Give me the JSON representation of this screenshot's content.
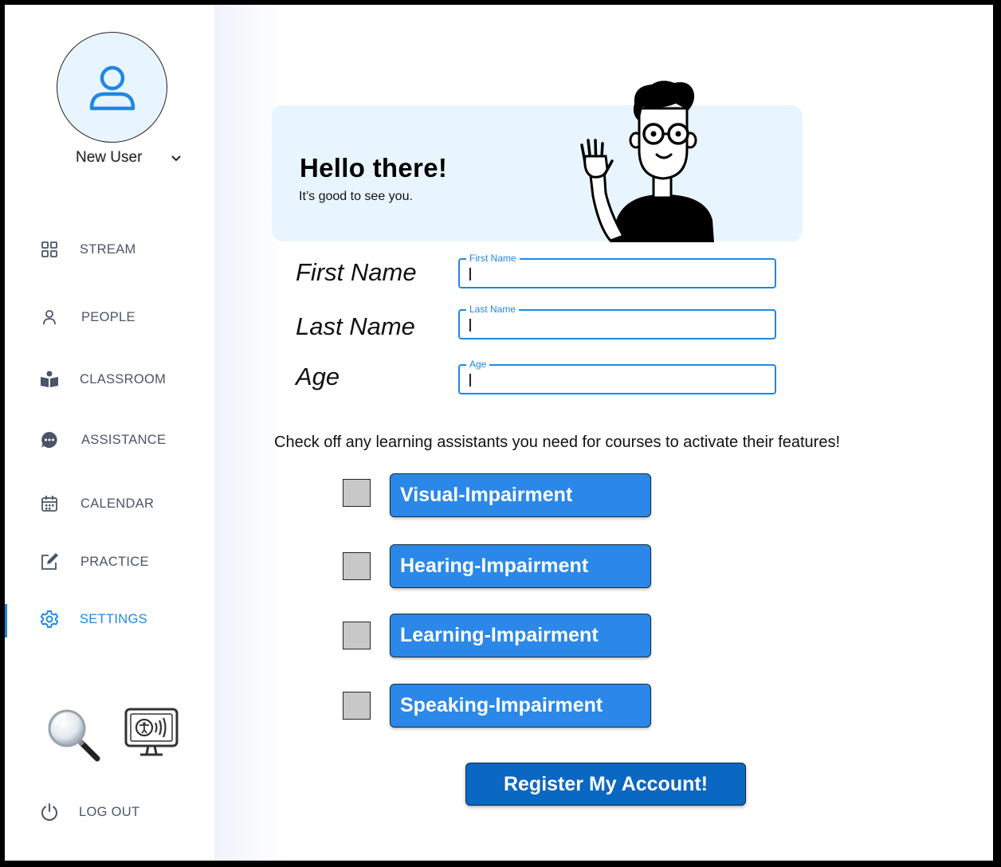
{
  "sidebar": {
    "user_name": "New User",
    "nav": [
      {
        "label": "STREAM",
        "icon": "grid-icon"
      },
      {
        "label": "PEOPLE",
        "icon": "person-icon"
      },
      {
        "label": "CLASSROOM",
        "icon": "book-reader-icon"
      },
      {
        "label": "ASSISTANCE",
        "icon": "chat-bubble-icon"
      },
      {
        "label": "CALENDAR",
        "icon": "calendar-icon"
      },
      {
        "label": "PRACTICE",
        "icon": "edit-icon"
      },
      {
        "label": "SETTINGS",
        "icon": "gear-icon",
        "active": true
      }
    ],
    "logout_label": "LOG OUT",
    "tools": [
      "magnifier-icon",
      "accessibility-monitor-icon"
    ]
  },
  "greeting": {
    "title": "Hello there!",
    "subtitle": "It’s good to see you."
  },
  "form": {
    "first_name": {
      "label": "First Name",
      "legend": "First Name",
      "value": ""
    },
    "last_name": {
      "label": "Last Name",
      "legend": "Last Name",
      "value": ""
    },
    "age": {
      "label": "Age",
      "legend": "Age",
      "value": ""
    }
  },
  "assistants": {
    "instruction": "Check off any learning assistants you need for courses to activate their features!",
    "options": [
      {
        "label": "Visual-Impairment",
        "checked": false
      },
      {
        "label": "Hearing-Impairment",
        "checked": false
      },
      {
        "label": "Learning-Impairment",
        "checked": false
      },
      {
        "label": "Speaking-Impairment",
        "checked": false
      }
    ]
  },
  "register_label": "Register My Account!",
  "colors": {
    "accent": "#1e88e5",
    "card_bg": "#e9f5fe",
    "button": "#2b88e8",
    "register": "#0a67c2",
    "checkbox": "#c8c8c8"
  }
}
